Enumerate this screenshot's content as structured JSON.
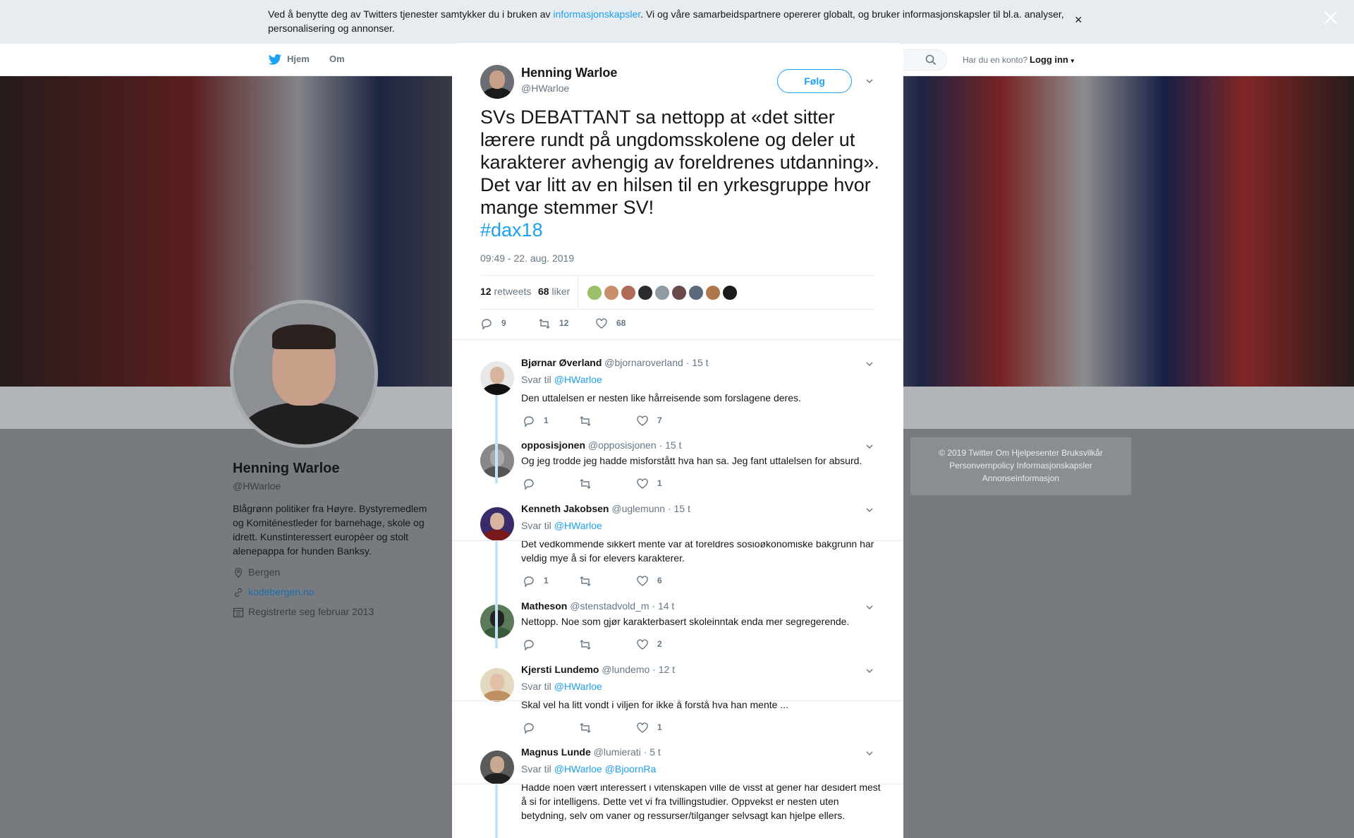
{
  "cookie": {
    "text_before": "Ved å benytte deg av Twitters tjenester samtykker du i bruken av ",
    "link": "informasjonskapsler",
    "text_after": ". Vi og våre samarbeidspartnere opererer globalt, og bruker informasjonskapsler til bl.a. analyser, personalisering og annonser.",
    "close": "×"
  },
  "nav": {
    "home": "Hjem",
    "about": "Om",
    "have_account": "Har du en konto?",
    "login": "Logg inn"
  },
  "profile": {
    "name": "Henning Warloe",
    "handle": "@HWarloe",
    "bio": "Blågrønn politiker fra Høyre. Bystyremedlem og Komiténestleder for barnehage, skole og idrett. Kunstinteressert europèer og stolt alenepappa for hunden Banksy.",
    "location": "Bergen",
    "website": "kodebergen.no",
    "joined": "Registrerte seg februar 2013"
  },
  "footer": {
    "line1": "© 2019 Twitter   Om   Hjelpesenter   Bruksvilkår",
    "line2": "Personvernpolicy   Informasjonskapsler",
    "line3": "Annonseinformasjon"
  },
  "tweet": {
    "name": "Henning Warloe",
    "handle": "@HWarloe",
    "follow": "Følg",
    "text": "SVs DEBATTANT sa nettopp at «det sitter lærere rundt på ungdomsskolene og deler ut karakterer avhengig av foreldrenes utdanning». Det var litt av en hilsen til en yrkesgruppe hvor mange stemmer SV!",
    "hashtag": "#dax18",
    "time": "09:49 - 22. aug. 2019",
    "retweets_count": "12",
    "retweets_label": "retweets",
    "likes_count": "68",
    "likes_label": "liker",
    "actions": {
      "replies": "9",
      "retweets": "12",
      "likes": "68"
    },
    "liker_avatar_colors": [
      "#9bbf6a",
      "#c98f6a",
      "#b06a5a",
      "#2b2b2b",
      "#8f9aa3",
      "#6a4a4a",
      "#5a6a7a",
      "#b0784a",
      "#1a1a1a"
    ]
  },
  "replies": [
    {
      "name": "Bjørnar Øverland",
      "handle": "@bjornaroverland",
      "time": "· 15 t",
      "svar_label": "Svar til",
      "mentions": "@HWarloe",
      "text": "Den uttalelsen er nesten like hårreisende som forslagene deres.",
      "reply": "1",
      "retweet": "",
      "like": "7"
    },
    {
      "name": "opposisjonen",
      "handle": "@opposisjonen",
      "time": "· 15 t",
      "text": "Og jeg trodde jeg hadde misforstått hva han sa. Jeg fant uttalelsen for absurd.",
      "reply": "",
      "retweet": "",
      "like": "1"
    },
    {
      "name": "Kenneth Jakobsen",
      "handle": "@uglemunn",
      "time": "· 15 t",
      "svar_label": "Svar til",
      "mentions": "@HWarloe",
      "text": "Det vedkommende sikkert mente var at foreldres sosioøkonomiske bakgrunn har veldig mye å si for elevers karakterer.",
      "reply": "1",
      "retweet": "",
      "like": "6"
    },
    {
      "name": "Matheson",
      "handle": "@stenstadvold_m",
      "time": "· 14 t",
      "text": "Nettopp. Noe som gjør karakterbasert skoleinntak enda mer segregerende.",
      "reply": "",
      "retweet": "",
      "like": "2"
    },
    {
      "name": "Kjersti Lundemo",
      "handle": "@lundemo",
      "time": "· 12 t",
      "svar_label": "Svar til",
      "mentions": "@HWarloe",
      "text": "Skal vel ha litt vondt i viljen for ikke å forstå hva han mente ...",
      "reply": "",
      "retweet": "",
      "like": "1"
    },
    {
      "name": "Magnus Lunde",
      "handle": "@lumierati",
      "time": "· 5 t",
      "svar_label": "Svar til",
      "mentions": "@HWarloe @BjoornRa",
      "text": "Hadde noen vært interessert i vitenskapen ville de visst at gener har desidert mest å si for intelligens. Dette vet vi fra tvillingstudier. Oppvekst er nesten uten betydning, selv om vaner og ressurser/tilganger selvsagt kan hjelpe ellers.",
      "reply": "",
      "retweet": "",
      "like": ""
    }
  ]
}
